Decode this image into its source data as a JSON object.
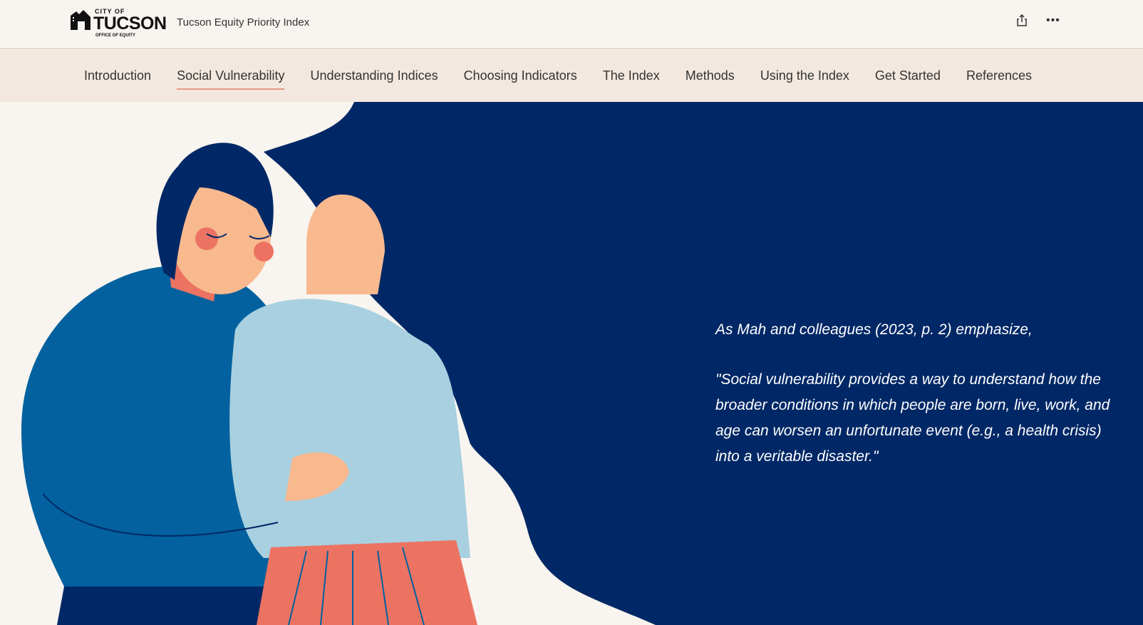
{
  "header": {
    "logo": {
      "line1": "CITY OF",
      "line2": "TUCSON",
      "line3": "OFFICE OF EQUITY"
    },
    "title": "Tucson Equity Priority Index",
    "icons": [
      "share-icon",
      "more-icon"
    ],
    "more_label": "•••"
  },
  "nav": {
    "items": [
      {
        "label": "Introduction"
      },
      {
        "label": "Social Vulnerability",
        "active": true
      },
      {
        "label": "Understanding Indices"
      },
      {
        "label": "Choosing Indicators"
      },
      {
        "label": "The Index"
      },
      {
        "label": "Methods"
      },
      {
        "label": "Using the Index"
      },
      {
        "label": "Get Started"
      },
      {
        "label": "References"
      }
    ]
  },
  "hero": {
    "intro": "As Mah and colleagues (2023, p. 2) emphasize,",
    "quote": "\"Social vulnerability provides a way to understand how the broader conditions in which people are born, live, work, and age can worsen an unfortunate event (e.g., a health crisis) into a veritable disaster.\""
  },
  "colors": {
    "panel": "#012866",
    "accent": "#e69a85"
  }
}
